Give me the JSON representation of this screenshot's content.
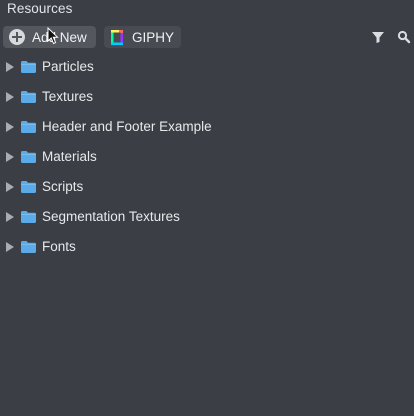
{
  "panel": {
    "title": "Resources"
  },
  "toolbar": {
    "add_new_label": "Add New",
    "giphy_label": "GIPHY",
    "icons": {
      "add": "plus-circle-icon",
      "giphy": "giphy-icon",
      "filter": "filter-icon",
      "search": "search-icon"
    }
  },
  "tree": {
    "items": [
      {
        "label": "Particles"
      },
      {
        "label": "Textures"
      },
      {
        "label": "Header and Footer Example"
      },
      {
        "label": "Materials"
      },
      {
        "label": "Scripts"
      },
      {
        "label": "Segmentation Textures"
      },
      {
        "label": "Fonts"
      }
    ]
  },
  "colors": {
    "background": "#3b3e44",
    "folder": "#5aabe8",
    "button": "#54575e",
    "text": "#e8e9ec"
  }
}
